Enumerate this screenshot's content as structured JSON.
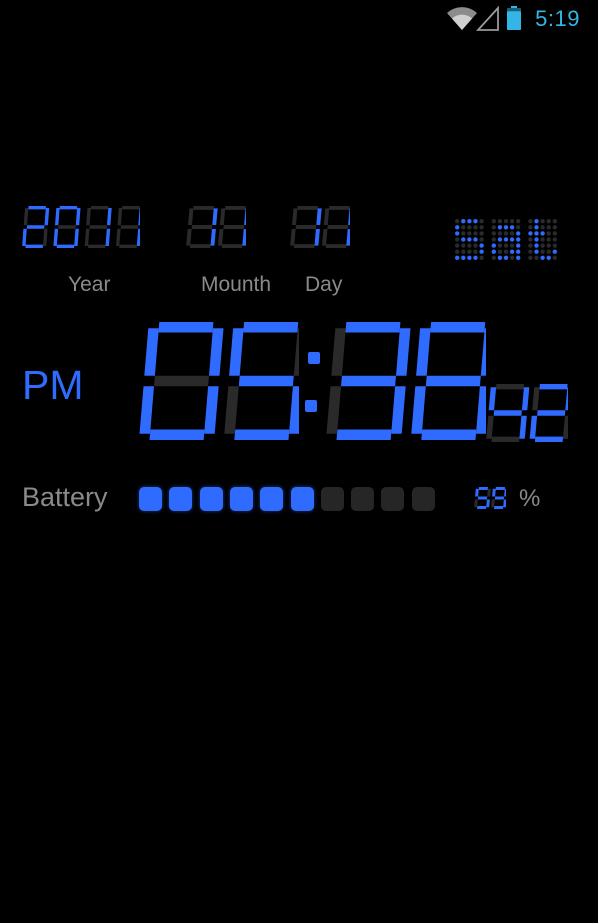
{
  "status_bar": {
    "time": "5:19",
    "icons": [
      "wifi-icon",
      "cell-signal-icon",
      "battery-icon"
    ],
    "accent": "#33b5e5",
    "battery_level": 0.85
  },
  "clock": {
    "on_color": "#2f6bff",
    "off_color": "#2a2a2a",
    "date": {
      "year": "2011",
      "month": "11",
      "day": "11",
      "year_label": "Year",
      "month_label": "Mounth",
      "day_label": "Day"
    },
    "weekday": "sat",
    "ampm": "PM",
    "hours": "05",
    "minutes": "38",
    "seconds": "42",
    "battery_label": "Battery",
    "battery_percent_value": "59",
    "battery_percent_sign": "%",
    "battery_cells_total": 10,
    "battery_cells_on": 6
  }
}
